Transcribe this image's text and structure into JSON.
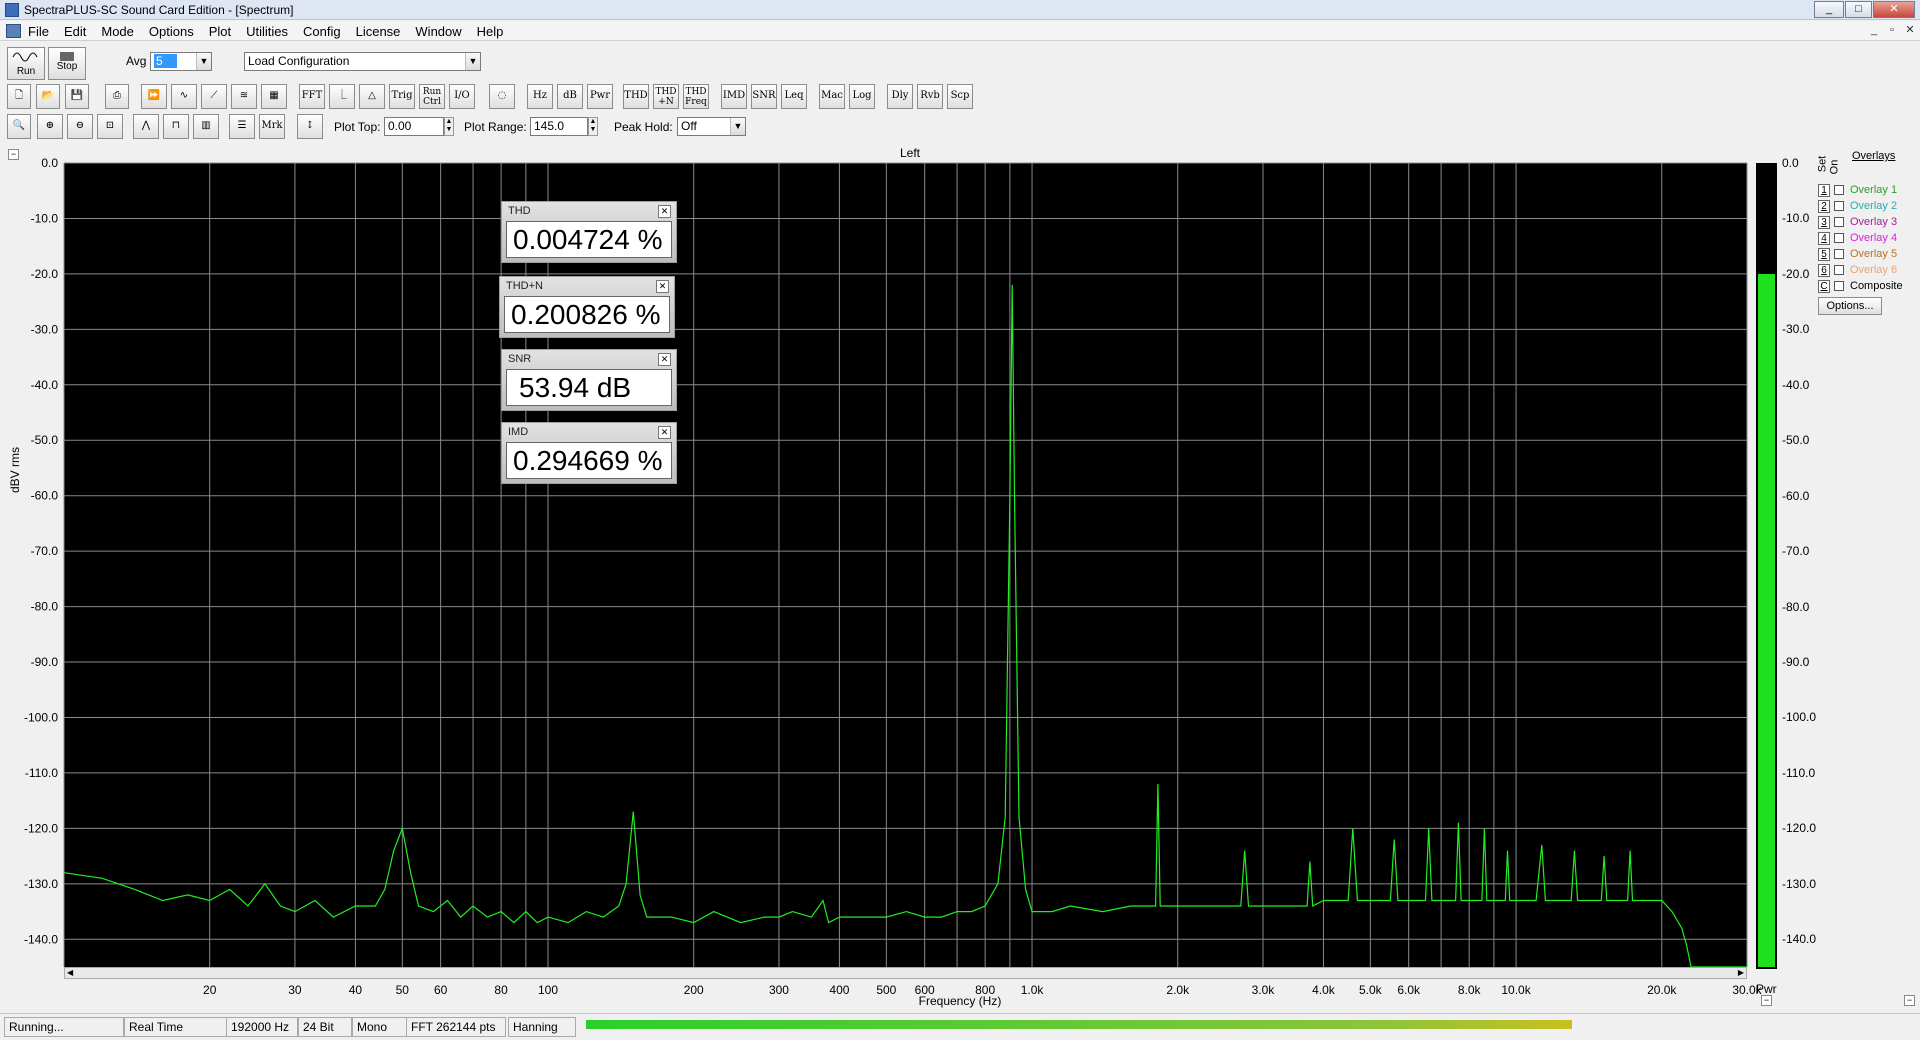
{
  "window": {
    "title": "SpectraPLUS-SC Sound Card Edition - [Spectrum]",
    "controls": [
      "_",
      "□",
      "✕"
    ]
  },
  "menu": {
    "items": [
      "File",
      "Edit",
      "Mode",
      "Options",
      "Plot",
      "Utilities",
      "Config",
      "License",
      "Window",
      "Help"
    ]
  },
  "toolbar1": {
    "run_label": "Run",
    "stop_label": "Stop",
    "avg_label": "Avg",
    "avg_value": "5",
    "config_value": "Load Configuration"
  },
  "toolbar2": {
    "buttons": [
      "FFT",
      "Trig",
      "Run Ctrl",
      "I/O",
      "Hz",
      "dB",
      "Pwr",
      "THD",
      "THD +N",
      "THD Freq",
      "IMD",
      "SNR",
      "Leq",
      "Mac",
      "Log",
      "Dly",
      "Rvb",
      "Scp"
    ]
  },
  "toolbar3": {
    "mrk_label": "Mrk",
    "plot_top_label": "Plot Top:",
    "plot_top_value": "0.00",
    "plot_range_label": "Plot Range:",
    "plot_range_value": "145.0",
    "peak_hold_label": "Peak Hold:",
    "peak_hold_value": "Off"
  },
  "plot": {
    "channel_title": "Left",
    "pwr_label": "Pwr"
  },
  "readouts": {
    "thd": {
      "label": "THD",
      "value": "0.004724 %"
    },
    "thdn": {
      "label": "THD+N",
      "value": "0.200826 %"
    },
    "snr": {
      "label": "SNR",
      "value": "53.94 dB"
    },
    "imd": {
      "label": "IMD",
      "value": "0.294669 %"
    }
  },
  "meter": {
    "level_db": -20.0,
    "labels": [
      "0.0",
      "-10.0",
      "-20.0",
      "-30.0",
      "-40.0",
      "-50.0",
      "-60.0",
      "-70.0",
      "-80.0",
      "-90.0",
      "-100.0",
      "-110.0",
      "-120.0",
      "-130.0",
      "-140.0"
    ],
    "color": "#1ee01e"
  },
  "overlays": {
    "title": "Overlays",
    "set_label": "Set",
    "on_label": "On",
    "rows": [
      {
        "num": "1",
        "name": "Overlay 1",
        "color": "#2aa02a"
      },
      {
        "num": "2",
        "name": "Overlay 2",
        "color": "#20b0b0"
      },
      {
        "num": "3",
        "name": "Overlay 3",
        "color": "#a020a0"
      },
      {
        "num": "4",
        "name": "Overlay 4",
        "color": "#e020e0"
      },
      {
        "num": "5",
        "name": "Overlay 5",
        "color": "#c07020"
      },
      {
        "num": "6",
        "name": "Overlay 6",
        "color": "#f0a070"
      },
      {
        "num": "C",
        "name": "Composite",
        "color": "#000000"
      }
    ],
    "options_label": "Options..."
  },
  "status": {
    "state": "Running...",
    "mode": "Real Time",
    "sample_rate": "192000 Hz",
    "bits": "24 Bit",
    "channels": "Mono",
    "fft": "FFT 262144 pts",
    "window": "Hanning"
  },
  "chart_data": {
    "type": "line",
    "title": "Left",
    "xlabel": "Frequency (Hz)",
    "ylabel": "dBV rms",
    "x_scale": "log",
    "xlim": [
      10,
      30000
    ],
    "ylim": [
      -145,
      0
    ],
    "y_ticks": [
      "0.0",
      "-10.0",
      "-20.0",
      "-30.0",
      "-40.0",
      "-50.0",
      "-60.0",
      "-70.0",
      "-80.0",
      "-90.0",
      "-100.0",
      "-110.0",
      "-120.0",
      "-130.0",
      "-140.0"
    ],
    "x_ticks": [
      {
        "v": 20,
        "label": "20"
      },
      {
        "v": 30,
        "label": "30"
      },
      {
        "v": 40,
        "label": "40"
      },
      {
        "v": 50,
        "label": "50"
      },
      {
        "v": 60,
        "label": "60"
      },
      {
        "v": 80,
        "label": "80"
      },
      {
        "v": 100,
        "label": "100"
      },
      {
        "v": 200,
        "label": "200"
      },
      {
        "v": 300,
        "label": "300"
      },
      {
        "v": 400,
        "label": "400"
      },
      {
        "v": 500,
        "label": "500"
      },
      {
        "v": 600,
        "label": "600"
      },
      {
        "v": 800,
        "label": "800"
      },
      {
        "v": 1000,
        "label": "1.0k"
      },
      {
        "v": 2000,
        "label": "2.0k"
      },
      {
        "v": 3000,
        "label": "3.0k"
      },
      {
        "v": 4000,
        "label": "4.0k"
      },
      {
        "v": 5000,
        "label": "5.0k"
      },
      {
        "v": 6000,
        "label": "6.0k"
      },
      {
        "v": 8000,
        "label": "8.0k"
      },
      {
        "v": 10000,
        "label": "10.0k"
      },
      {
        "v": 20000,
        "label": "20.0k"
      },
      {
        "v": 30000,
        "label": "30.0k"
      }
    ],
    "grid": true,
    "line_color": "#22ee22",
    "series": [
      {
        "points": [
          [
            10,
            -128
          ],
          [
            12,
            -129
          ],
          [
            14,
            -131
          ],
          [
            16,
            -133
          ],
          [
            18,
            -132
          ],
          [
            20,
            -133
          ],
          [
            22,
            -131
          ],
          [
            24,
            -134
          ],
          [
            26,
            -130
          ],
          [
            28,
            -134
          ],
          [
            30,
            -135
          ],
          [
            33,
            -133
          ],
          [
            36,
            -136
          ],
          [
            40,
            -134
          ],
          [
            44,
            -134
          ],
          [
            46,
            -131
          ],
          [
            48,
            -124
          ],
          [
            50,
            -120
          ],
          [
            52,
            -128
          ],
          [
            54,
            -134
          ],
          [
            58,
            -135
          ],
          [
            62,
            -133
          ],
          [
            66,
            -136
          ],
          [
            70,
            -134
          ],
          [
            75,
            -136
          ],
          [
            80,
            -135
          ],
          [
            85,
            -137
          ],
          [
            90,
            -135
          ],
          [
            95,
            -137
          ],
          [
            100,
            -136
          ],
          [
            110,
            -137
          ],
          [
            120,
            -135
          ],
          [
            130,
            -136
          ],
          [
            140,
            -134
          ],
          [
            145,
            -130
          ],
          [
            150,
            -117
          ],
          [
            155,
            -132
          ],
          [
            160,
            -136
          ],
          [
            180,
            -136
          ],
          [
            200,
            -137
          ],
          [
            220,
            -135
          ],
          [
            250,
            -137
          ],
          [
            280,
            -136
          ],
          [
            300,
            -136
          ],
          [
            320,
            -135
          ],
          [
            350,
            -136
          ],
          [
            370,
            -133
          ],
          [
            380,
            -137
          ],
          [
            400,
            -136
          ],
          [
            450,
            -136
          ],
          [
            500,
            -136
          ],
          [
            550,
            -135
          ],
          [
            600,
            -136
          ],
          [
            650,
            -136
          ],
          [
            700,
            -135
          ],
          [
            750,
            -135
          ],
          [
            800,
            -134
          ],
          [
            850,
            -130
          ],
          [
            880,
            -118
          ],
          [
            900,
            -60
          ],
          [
            910,
            -22
          ],
          [
            920,
            -60
          ],
          [
            940,
            -118
          ],
          [
            970,
            -131
          ],
          [
            1000,
            -135
          ],
          [
            1100,
            -135
          ],
          [
            1200,
            -134
          ],
          [
            1400,
            -135
          ],
          [
            1600,
            -134
          ],
          [
            1750,
            -134
          ],
          [
            1800,
            -134
          ],
          [
            1820,
            -112
          ],
          [
            1840,
            -134
          ],
          [
            2000,
            -134
          ],
          [
            2200,
            -134
          ],
          [
            2500,
            -134
          ],
          [
            2700,
            -134
          ],
          [
            2750,
            -124
          ],
          [
            2800,
            -134
          ],
          [
            3000,
            -134
          ],
          [
            3500,
            -134
          ],
          [
            3700,
            -134
          ],
          [
            3750,
            -126
          ],
          [
            3800,
            -134
          ],
          [
            4000,
            -133
          ],
          [
            4500,
            -133
          ],
          [
            4600,
            -120
          ],
          [
            4700,
            -133
          ],
          [
            5000,
            -133
          ],
          [
            5500,
            -133
          ],
          [
            5600,
            -122
          ],
          [
            5700,
            -133
          ],
          [
            6000,
            -133
          ],
          [
            6500,
            -133
          ],
          [
            6600,
            -120
          ],
          [
            6700,
            -133
          ],
          [
            7000,
            -133
          ],
          [
            7500,
            -133
          ],
          [
            7600,
            -119
          ],
          [
            7700,
            -133
          ],
          [
            8000,
            -133
          ],
          [
            8500,
            -133
          ],
          [
            8600,
            -120
          ],
          [
            8700,
            -133
          ],
          [
            9000,
            -133
          ],
          [
            9500,
            -133
          ],
          [
            9600,
            -124
          ],
          [
            9700,
            -133
          ],
          [
            10000,
            -133
          ],
          [
            11000,
            -133
          ],
          [
            11300,
            -123
          ],
          [
            11500,
            -133
          ],
          [
            12000,
            -133
          ],
          [
            13000,
            -133
          ],
          [
            13200,
            -124
          ],
          [
            13400,
            -133
          ],
          [
            14000,
            -133
          ],
          [
            15000,
            -133
          ],
          [
            15200,
            -125
          ],
          [
            15400,
            -133
          ],
          [
            16000,
            -133
          ],
          [
            17000,
            -133
          ],
          [
            17200,
            -124
          ],
          [
            17400,
            -133
          ],
          [
            18000,
            -133
          ],
          [
            19000,
            -133
          ],
          [
            20000,
            -133
          ],
          [
            21000,
            -135
          ],
          [
            22000,
            -138
          ],
          [
            22500,
            -141
          ],
          [
            23000,
            -145
          ],
          [
            24000,
            -145
          ],
          [
            25000,
            -145
          ],
          [
            26000,
            -145
          ],
          [
            28000,
            -145
          ],
          [
            30000,
            -145
          ]
        ]
      }
    ]
  }
}
